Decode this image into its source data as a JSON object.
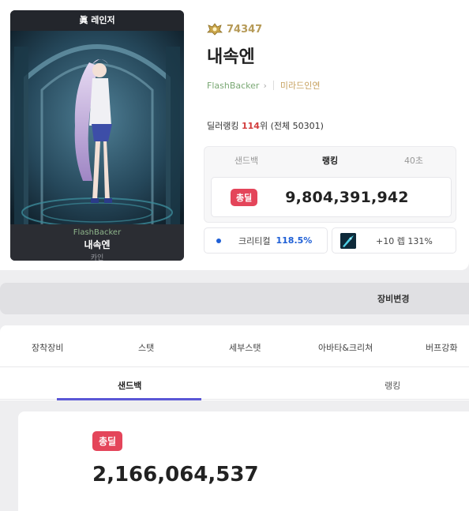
{
  "character": {
    "job_title": "眞 레인저",
    "adventure_name": "FlashBacker",
    "name": "내속엔",
    "server": "카인",
    "fame": "74347",
    "guild": "미라드인연"
  },
  "ranking": {
    "prefix": "딜러랭킹 ",
    "rank": "114",
    "rank_suffix": "위 (전체 50301)",
    "tabs": [
      "샌드백",
      "랭킹",
      "40초"
    ],
    "active_tab": "랭킹",
    "badge": "총딜",
    "damage": "9,804,391,942"
  },
  "stats": {
    "crit_label": "크리티컬",
    "crit_value": "118.5%",
    "buff_text": "+10 렙 131%"
  },
  "equip_change_label": "장비변경",
  "main_tabs": [
    "장착장비",
    "스탯",
    "세부스탯",
    "아바타&크리쳐",
    "버프강화"
  ],
  "sub_tabs": [
    "샌드백",
    "랭킹"
  ],
  "active_sub_tab": "샌드백",
  "result": {
    "badge": "총딜",
    "damage": "2,166,064,537"
  },
  "colors": {
    "accent": "#5b57d6",
    "badge_red": "#e4455a",
    "crit_blue": "#1e5fd6",
    "fame_gold": "#b69a57"
  },
  "icons": {
    "fame": "fame-crest-icon",
    "chevron": "chevron-right-icon",
    "crit": "dot-icon",
    "buff": "skill-thumbnail-icon"
  }
}
